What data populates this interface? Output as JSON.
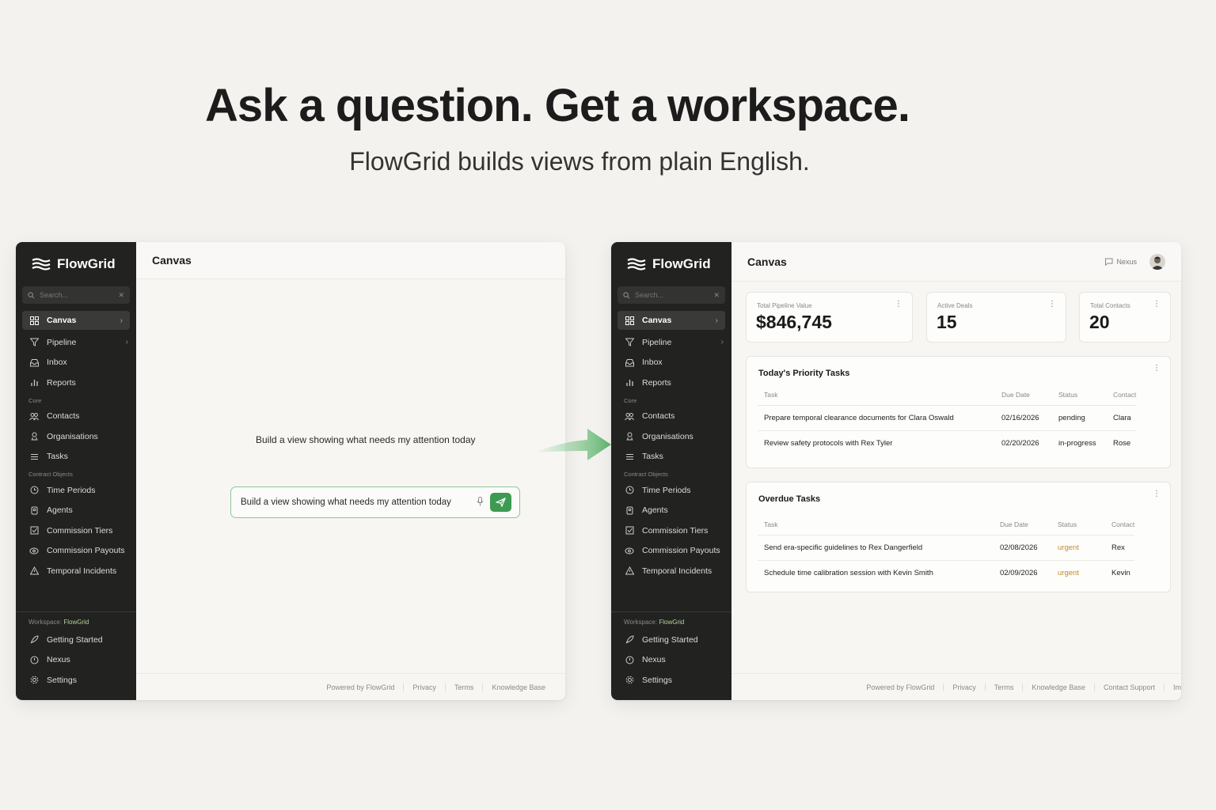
{
  "hero": {
    "title": "Ask a question.  Get a workspace.",
    "subtitle": "FlowGrid builds views from plain English."
  },
  "colors": {
    "sidebar_bg": "#222221",
    "accent_green": "#3d9a52",
    "urgent": "#c98a2a"
  },
  "sidebar": {
    "brand": "FlowGrid",
    "search_placeholder": "Search...",
    "primary": [
      {
        "label": "Canvas",
        "icon": "grid-icon"
      },
      {
        "label": "Pipeline",
        "icon": "filter-icon"
      },
      {
        "label": "Inbox",
        "icon": "inbox-icon"
      },
      {
        "label": "Reports",
        "icon": "bar-chart-icon"
      }
    ],
    "core_label": "Core",
    "core": [
      {
        "label": "Contacts",
        "icon": "contacts-icon"
      },
      {
        "label": "Organisations",
        "icon": "organisation-icon"
      },
      {
        "label": "Tasks",
        "icon": "list-icon"
      }
    ],
    "custom_label": "Contract Objects",
    "custom": [
      {
        "label": "Time Periods",
        "icon": "clock-icon"
      },
      {
        "label": "Agents",
        "icon": "agent-icon"
      },
      {
        "label": "Commission Tiers",
        "icon": "checkbox-icon"
      },
      {
        "label": "Commission Payouts",
        "icon": "payout-icon"
      },
      {
        "label": "Temporal Incidents",
        "icon": "warning-icon"
      }
    ],
    "workspace_prefix": "Workspace:",
    "workspace_name": "FlowGrid",
    "bottom": [
      {
        "label": "Getting Started",
        "icon": "rocket-icon"
      },
      {
        "label": "Nexus",
        "icon": "nexus-icon"
      },
      {
        "label": "Settings",
        "icon": "settings-icon"
      }
    ]
  },
  "left_panel": {
    "title": "Canvas",
    "prompt_text": "Build a view showing what needs my attention today",
    "input_value": "Build a view showing what needs my attention today",
    "footer": [
      "Powered by FlowGrid",
      "Privacy",
      "Terms",
      "Knowledge Base"
    ]
  },
  "right_panel": {
    "title": "Canvas",
    "nexus_label": "Nexus",
    "kpis": [
      {
        "label": "Total Pipeline Value",
        "value": "$846,745"
      },
      {
        "label": "Active Deals",
        "value": "15"
      },
      {
        "label": "Total Contacts",
        "value": "20"
      }
    ],
    "priority": {
      "title": "Today's Priority Tasks",
      "columns": [
        "Task",
        "Due Date",
        "Status",
        "Contact"
      ],
      "rows": [
        [
          "Prepare temporal clearance documents for Clara Oswald",
          "02/16/2026",
          "pending",
          "Clara"
        ],
        [
          "Review safety protocols with Rex Tyler",
          "02/20/2026",
          "in-progress",
          "Rose"
        ]
      ]
    },
    "overdue": {
      "title": "Overdue Tasks",
      "columns": [
        "Task",
        "Due Date",
        "Status",
        "Contact"
      ],
      "rows": [
        [
          "Send era-specific guidelines to Rex Dangerfield",
          "02/08/2026",
          "urgent",
          "Rex"
        ],
        [
          "Schedule time calibration session with Kevin Smith",
          "02/09/2026",
          "urgent",
          "Kevin"
        ]
      ]
    },
    "footer": [
      "Powered by FlowGrid",
      "Privacy",
      "Terms",
      "Knowledge Base",
      "Contact Support",
      "Im"
    ]
  }
}
